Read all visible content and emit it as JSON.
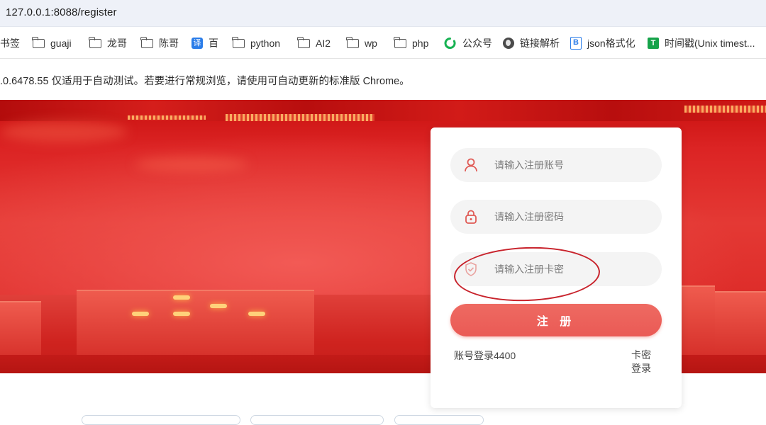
{
  "browser": {
    "url": "127.0.0.1:8088/register"
  },
  "bookmarks": [
    {
      "label": "书签",
      "icon": "none"
    },
    {
      "label": "guaji",
      "icon": "folder-icon"
    },
    {
      "label": "龙哥",
      "icon": "folder-icon"
    },
    {
      "label": "陈哥",
      "icon": "folder-icon"
    },
    {
      "label": "百",
      "icon": "translate-icon",
      "icon_text": "译"
    },
    {
      "label": "python",
      "icon": "folder-icon"
    },
    {
      "label": "AI2",
      "icon": "folder-icon"
    },
    {
      "label": "wp",
      "icon": "folder-icon"
    },
    {
      "label": "php",
      "icon": "folder-icon"
    },
    {
      "label": "公众号",
      "icon": "wechat-icon"
    },
    {
      "label": "链接解析",
      "icon": "globe-icon"
    },
    {
      "label": "json格式化",
      "icon": "bejson-icon",
      "icon_text": "B"
    },
    {
      "label": "时间戳(Unix timest...",
      "icon": "timestamp-icon",
      "icon_text": "T"
    }
  ],
  "infobar": {
    "message": ".0.6478.55 仅适用于自动测试。若要进行常规浏览，请使用可自动更新的标准版 Chrome。"
  },
  "register_form": {
    "account_placeholder": "请输入注册账号",
    "password_placeholder": "请输入注册密码",
    "card_key_placeholder": "请输入注册卡密",
    "submit_label": "注 册",
    "account_login_link": "账号登录4400",
    "card_login_link": "卡密登录"
  },
  "colors": {
    "accent": "#ea5a55",
    "hero_red": "#dc2424",
    "annotation": "#c8232c"
  }
}
